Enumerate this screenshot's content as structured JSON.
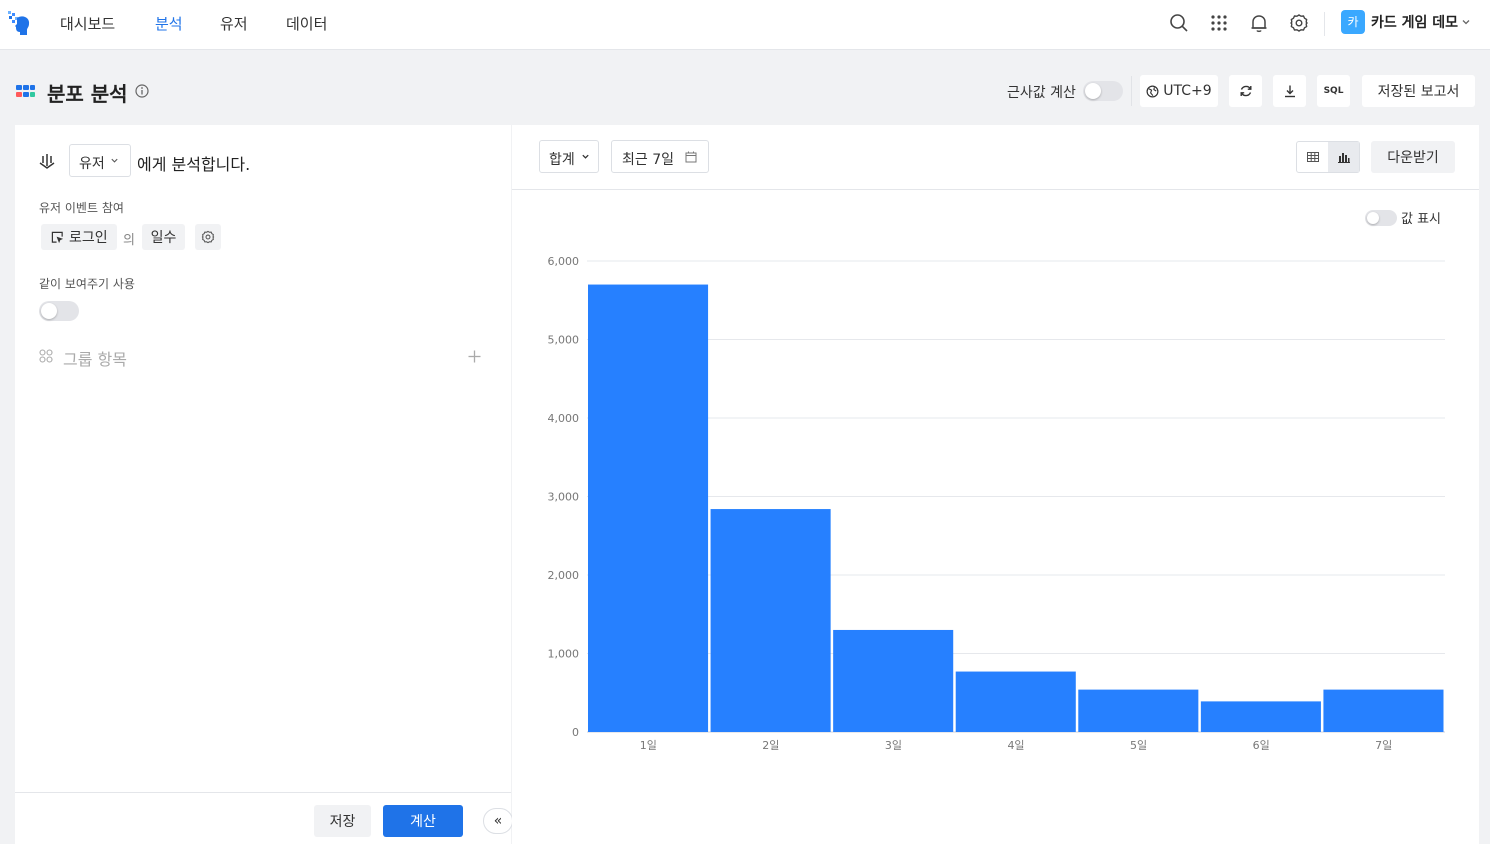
{
  "nav": {
    "items": [
      "대시보드",
      "분석",
      "유저",
      "데이터"
    ],
    "active_index": 1,
    "project_avatar": "카",
    "project_name": "카드 게임 데모"
  },
  "header": {
    "title": "분포 분석",
    "approx_label": "근사값 계산",
    "approx_enabled": false,
    "timezone": "UTC+9",
    "sql_label": "SQL",
    "saved_reports": "저장된 보고서"
  },
  "left": {
    "subject_select": "유저",
    "analyze_text": "에게 분석합니다.",
    "event_section_label": "유저 이벤트 참여",
    "event_chip": "로그인",
    "of_text": "의",
    "metric_chip": "일수",
    "compare_label": "같이 보여주기 사용",
    "compare_enabled": false,
    "group_label": "그룹 항목",
    "save_button": "저장",
    "calc_button": "계산",
    "collapse": "«"
  },
  "right": {
    "agg_select": "합계",
    "date_range": "최근 7일",
    "download_button": "다운받기",
    "show_values_label": "값 표시",
    "show_values_enabled": false,
    "active_view": "chart"
  },
  "colors": {
    "accent": "#1f73e8",
    "bar": "#2680ff"
  },
  "chart_data": {
    "type": "bar",
    "categories": [
      "1일",
      "2일",
      "3일",
      "4일",
      "5일",
      "6일",
      "7일"
    ],
    "values": [
      5700,
      2840,
      1300,
      770,
      540,
      390,
      540
    ],
    "ylim": [
      0,
      6000
    ],
    "yticks": [
      "0",
      "1,000",
      "2,000",
      "3,000",
      "4,000",
      "5,000",
      "6,000"
    ],
    "grid": true,
    "legend": "none"
  }
}
